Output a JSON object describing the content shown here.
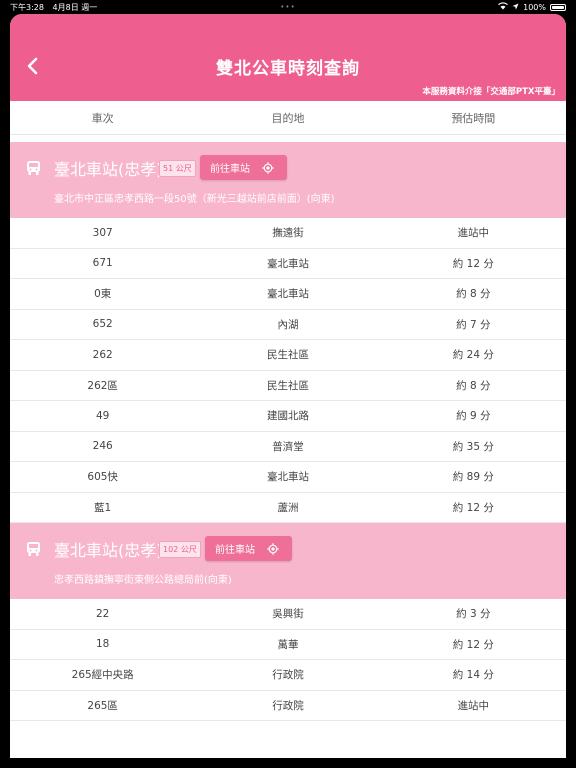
{
  "status": {
    "time": "下午3:28",
    "date": "4月8日 週一",
    "battery": "100%"
  },
  "header": {
    "title": "雙北公車時刻查詢",
    "credit": "本服務資料介接「交通部PTX平臺」"
  },
  "columns": [
    "車次",
    "目的地",
    "預估時間"
  ],
  "stations": [
    {
      "name": "臺北車站(忠孝)",
      "distance": "51 公尺",
      "go_label": "前往車站",
      "address": "臺北市中正區忠孝西路一段50號（新光三越站前店前面）(向東)",
      "rows": [
        [
          "307",
          "撫遠街",
          "進站中"
        ],
        [
          "671",
          "臺北車站",
          "約 12 分"
        ],
        [
          "0東",
          "臺北車站",
          "約 8 分"
        ],
        [
          "652",
          "內湖",
          "約 7 分"
        ],
        [
          "262",
          "民生社區",
          "約 24 分"
        ],
        [
          "262區",
          "民生社區",
          "約 8 分"
        ],
        [
          "49",
          "建國北路",
          "約 9 分"
        ],
        [
          "246",
          "普濟堂",
          "約 35 分"
        ],
        [
          "605快",
          "臺北車站",
          "約 89 分"
        ],
        [
          "藍1",
          "蘆洲",
          "約 12 分"
        ]
      ]
    },
    {
      "name": "臺北車站(忠孝)",
      "distance": "102 公尺",
      "go_label": "前往車站",
      "address": "忠孝西路鎮撫寧街東側公路總局前(向東)",
      "rows": [
        [
          "22",
          "吳興街",
          "約 3 分"
        ],
        [
          "18",
          "萬華",
          "約 12 分"
        ],
        [
          "265經中央路",
          "行政院",
          "約 14 分"
        ],
        [
          "265區",
          "行政院",
          "進站中"
        ]
      ]
    }
  ],
  "colors": {
    "accent": "#ee5f8f",
    "station_bg": "#f8b6cd"
  }
}
